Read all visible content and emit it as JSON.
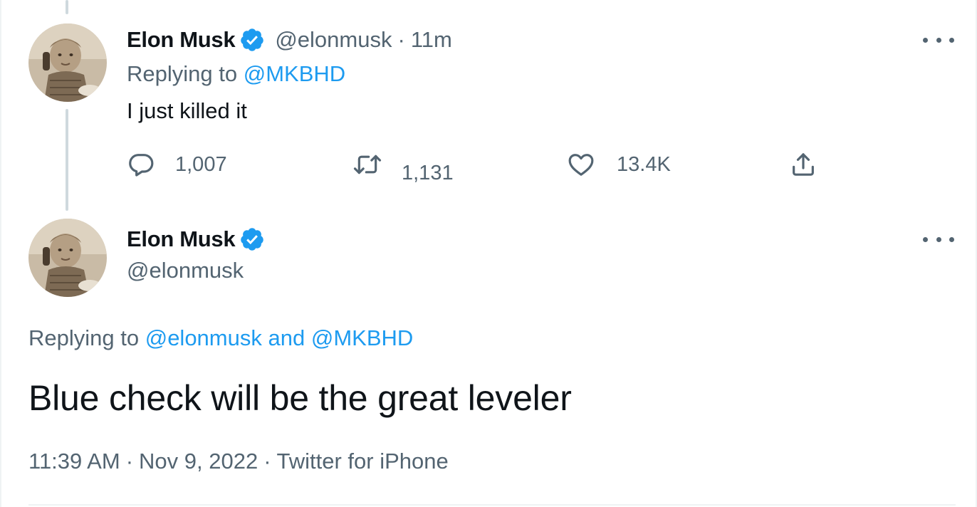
{
  "reply_tweet": {
    "author": {
      "display_name": "Elon Musk",
      "handle": "@elonmusk",
      "verified": true
    },
    "time_ago": "11m",
    "separator": "·",
    "replying_prefix": "Replying to",
    "replying_to": "@MKBHD",
    "text": "I just killed it",
    "actions": {
      "replies": "1,007",
      "retweets": "1,131",
      "likes": "13.4K"
    }
  },
  "main_tweet": {
    "author": {
      "display_name": "Elon Musk",
      "handle": "@elonmusk",
      "verified": true
    },
    "replying_prefix": "Replying to",
    "replying_mention_1": "@elonmusk",
    "replying_and": "and",
    "replying_mention_2": "@MKBHD",
    "text": "Blue check will be the great leveler",
    "time": "11:39 AM",
    "date": "Nov 9, 2022",
    "source": "Twitter for iPhone",
    "separator": "·"
  },
  "icons": {
    "verified": "verified-badge-icon",
    "reply": "speech-bubble-icon",
    "retweet": "retweet-arrows-icon",
    "like": "heart-icon",
    "share": "share-upload-icon",
    "more": "more-dots-icon"
  },
  "colors": {
    "accent": "#1d9bf0",
    "secondary_text": "#536471",
    "primary_text": "#0f1419",
    "thread_line": "#cfd9de"
  }
}
